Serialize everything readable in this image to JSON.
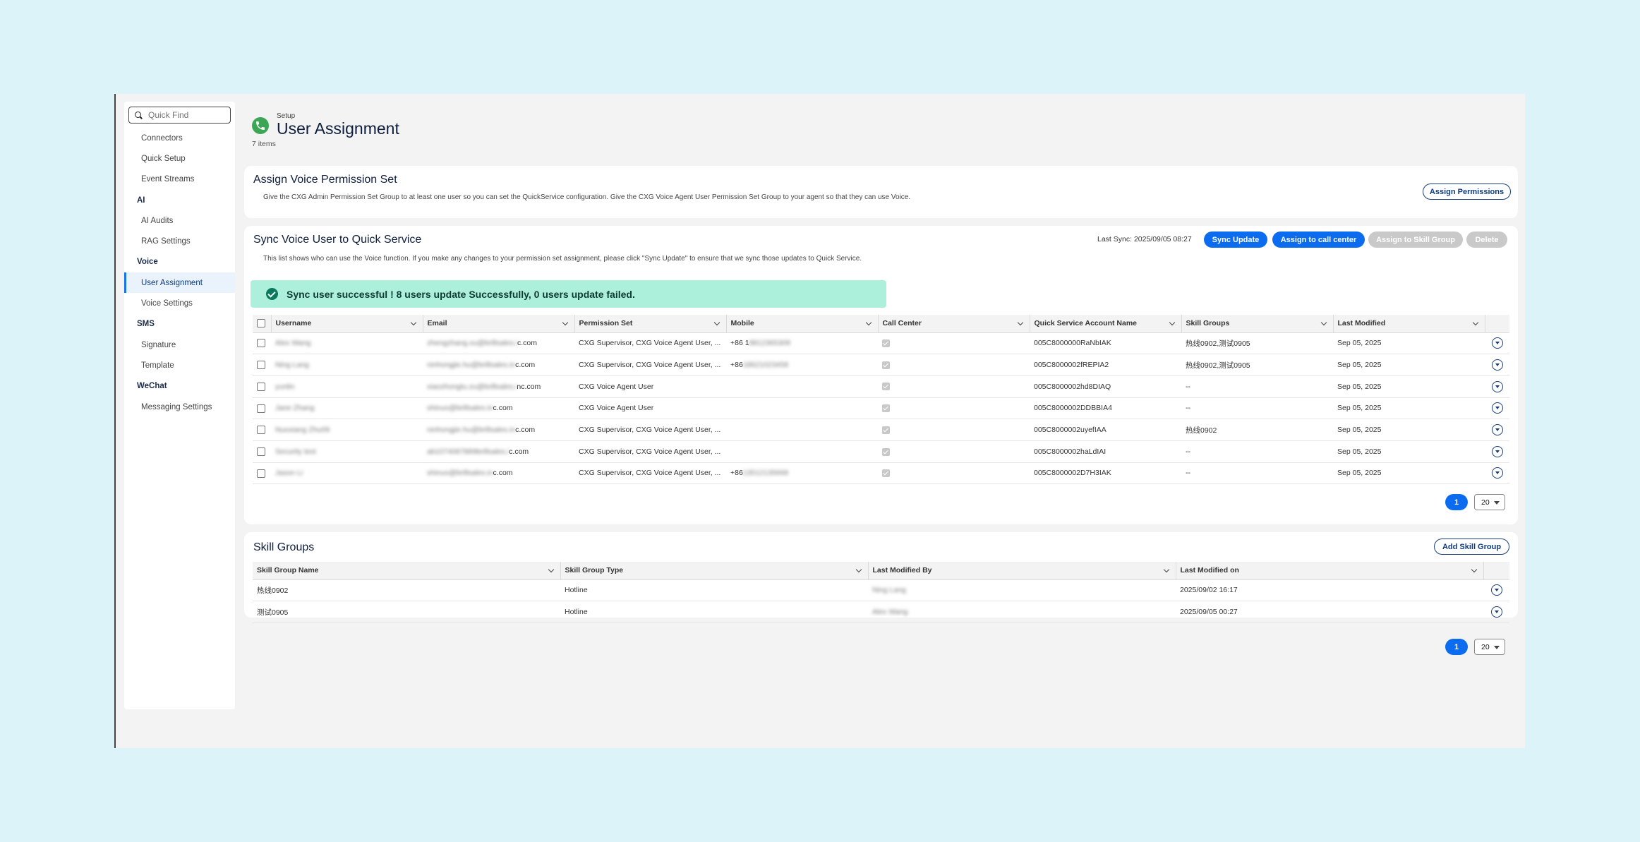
{
  "sidebar": {
    "quick_find_placeholder": "Quick Find",
    "items": [
      {
        "label": "Connectors",
        "type": "item"
      },
      {
        "label": "Quick Setup",
        "type": "item"
      },
      {
        "label": "Event Streams",
        "type": "item"
      },
      {
        "label": "AI",
        "type": "header"
      },
      {
        "label": "AI Audits",
        "type": "item"
      },
      {
        "label": "RAG Settings",
        "type": "item"
      },
      {
        "label": "Voice",
        "type": "header"
      },
      {
        "label": "User Assignment",
        "type": "item",
        "active": true
      },
      {
        "label": "Voice Settings",
        "type": "item"
      },
      {
        "label": "SMS",
        "type": "header"
      },
      {
        "label": "Signature",
        "type": "item"
      },
      {
        "label": "Template",
        "type": "item"
      },
      {
        "label": "WeChat",
        "type": "header"
      },
      {
        "label": "Messaging Settings",
        "type": "item"
      }
    ]
  },
  "header": {
    "breadcrumb": "Setup",
    "title": "User Assignment",
    "count": "7 items",
    "icon": "phone-icon",
    "icon_color": "#3ba755"
  },
  "assign": {
    "title": "Assign Voice Permission Set",
    "desc": "Give the CXG Admin Permission Set Group to at least one user so you can set the QuickService configuration. Give the CXG Voice Agent User Permission Set Group to your agent so that they can use Voice.",
    "button": "Assign Permissions"
  },
  "sync": {
    "title": "Sync Voice User to Quick Service",
    "desc": "This list shows who can use the Voice function. If you make any changes to your permission set assignment, please click \"Sync Update\" to ensure that we sync those updates to Quick Service.",
    "last_sync": "Last Sync: 2025/09/05 08:27",
    "buttons": {
      "sync_update": "Sync Update",
      "assign_call_center": "Assign to call center",
      "assign_skill_group": "Assign to Skill Group",
      "delete": "Delete"
    },
    "toast": "Sync user successful ! 8 users update Successfully, 0 users update failed.",
    "columns": [
      "Username",
      "Email",
      "Permission Set",
      "Mobile",
      "Call Center",
      "Quick Service Account Name",
      "Skill Groups",
      "Last Modified"
    ],
    "rows": [
      {
        "username": "Alex Wang",
        "email_hidden": "zhengzhang.xu@brillsales.i",
        "email_visible": "c.com",
        "permission": "CXG Supervisor, CXG Voice Agent User, ...",
        "mobile_prefix": "+86 1",
        "mobile_hidden": "8812365309",
        "account": "005C8000000RaNbIAK",
        "skills": "热线0902,测试0905",
        "modified": "Sep 05, 2025"
      },
      {
        "username": "Ning Lang",
        "email_hidden": "ninhongjie.hu@brillsales.in",
        "email_visible": "c.com",
        "permission": "CXG Supervisor, CXG Voice Agent User, ...",
        "mobile_prefix": "+86",
        "mobile_hidden": "18621023458",
        "account": "005C8000002fREPIA2",
        "skills": "热线0902,测试0905",
        "modified": "Sep 05, 2025"
      },
      {
        "username": "yunlin",
        "email_hidden": "xiaozhongtu.zu@brillsales.i",
        "email_visible": "nc.com",
        "permission": "CXG Voice Agent User",
        "mobile_prefix": "",
        "mobile_hidden": "",
        "account": "005C8000002hd8DIAQ",
        "skills": "--",
        "modified": "Sep 05, 2025"
      },
      {
        "username": "Jane Zhang",
        "email_hidden": "shinuo@brillsales.in",
        "email_visible": "c.com",
        "permission": "CXG Voice Agent User",
        "mobile_prefix": "",
        "mobile_hidden": "",
        "account": "005C8000002DDBBIA4",
        "skills": "--",
        "modified": "Sep 05, 2025"
      },
      {
        "username": "Nuoxiang Zhu09",
        "email_hidden": "ninhongjie.hu@brillsales.in",
        "email_visible": "c.com",
        "permission": "CXG Supervisor, CXG Voice Agent User, ...",
        "mobile_prefix": "",
        "mobile_hidden": "",
        "account": "005C8000002uyefIAA",
        "skills": "热线0902",
        "modified": "Sep 05, 2025"
      },
      {
        "username": "Security test",
        "email_hidden": "ab1074087889brillsales.i",
        "email_visible": "c.com",
        "permission": "CXG Supervisor, CXG Voice Agent User, ...",
        "mobile_prefix": "",
        "mobile_hidden": "",
        "account": "005C8000002haLdIAI",
        "skills": "--",
        "modified": "Sep 05, 2025"
      },
      {
        "username": "Jason Li",
        "email_hidden": "shinuo@brillsales.in",
        "email_visible": "c.com",
        "permission": "CXG Supervisor, CXG Voice Agent User, ...",
        "mobile_prefix": "+86",
        "mobile_hidden": "13512135668",
        "account": "005C8000002D7H3IAK",
        "skills": "--",
        "modified": "Sep 05, 2025"
      }
    ],
    "page": "1",
    "page_size": "20"
  },
  "skill": {
    "title": "Skill Groups",
    "button": "Add Skill Group",
    "columns": [
      "Skill Group Name",
      "Skill Group Type",
      "Last Modified By",
      "Last Modified on"
    ],
    "rows": [
      {
        "name": "热线0902",
        "type": "Hotline",
        "by": "Ning Lang",
        "on": "2025/09/02 16:17"
      },
      {
        "name": "测试0905",
        "type": "Hotline",
        "by": "Alex Wang",
        "on": "2025/09/05 00:27"
      }
    ],
    "page": "1",
    "page_size": "20"
  },
  "colors": {
    "primary": "#0b6cf0",
    "success_bg": "#acf0dc",
    "background": "#dcf3f9"
  }
}
